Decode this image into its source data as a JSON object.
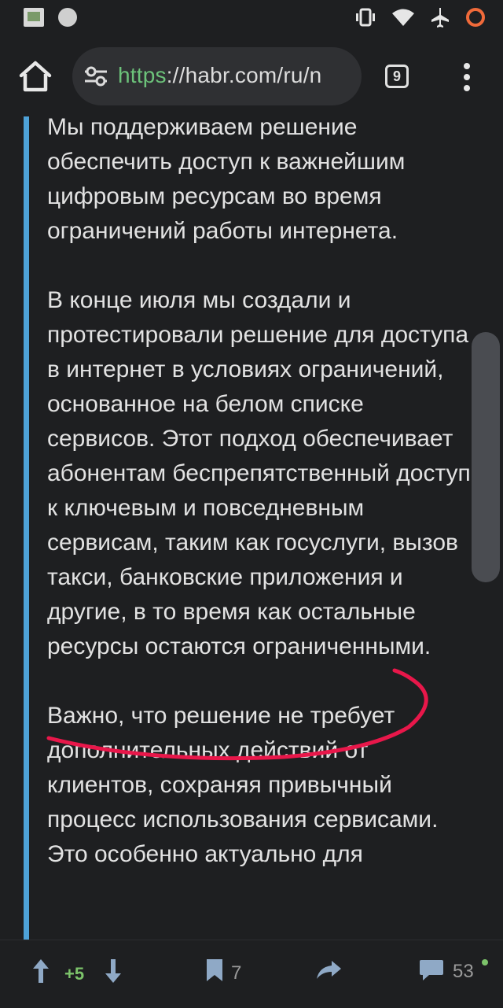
{
  "browser": {
    "url_scheme": "https",
    "url_rest": "://habr.com/ru/n",
    "tab_count": "9"
  },
  "article": {
    "paragraphs": [
      "Мы поддерживаем решение обеспечить доступ к важнейшим цифровым ресурсам во время ограничений работы интернета.",
      "В конце июля мы создали и протестировали решение для доступа в интернет в условиях ограничений, основанное на белом списке сервисов. Этот подход обеспечивает абонентам беспрепятственный доступ к ключевым и повседневным сервисам, таким как госуслуги, вызов такси, банковские приложения и другие, в то время как остальные ресурсы остаются ограниченными.",
      "Важно, что решение не требует дополнительных действий от клиентов, сохраняя привычный процесс использования сервисами. Это особенно актуально для"
    ]
  },
  "bottom_bar": {
    "score": "+5",
    "bookmarks": "7",
    "comments": "53"
  },
  "colors": {
    "background": "#1e1f21",
    "quote_bar": "#4ea2d8",
    "annotation": "#e8174a",
    "score_green": "#7cc36a",
    "url_scheme_green": "#6cc27a"
  }
}
